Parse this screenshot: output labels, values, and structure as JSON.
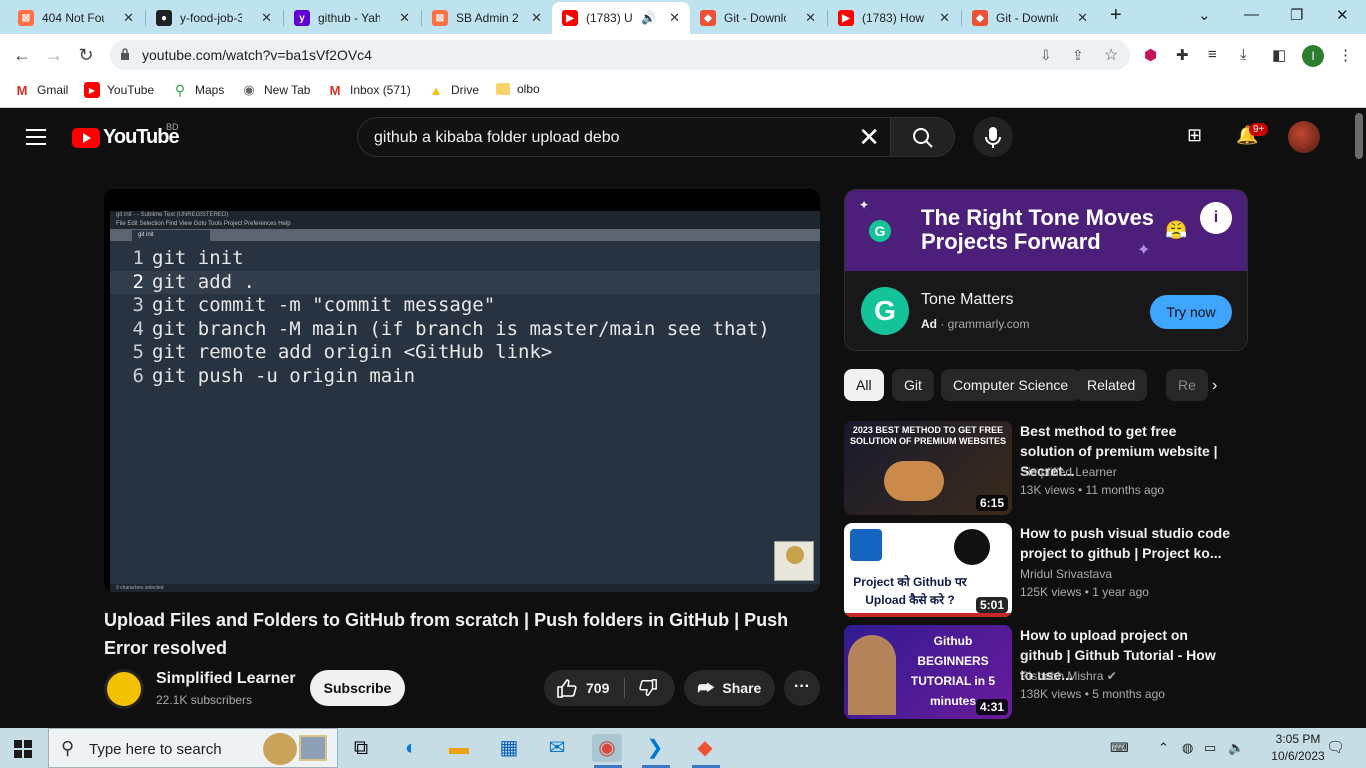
{
  "browser": {
    "tabs": [
      {
        "label": "404 Not Fou",
        "favicon_color": "#ff7043"
      },
      {
        "label": "y-food-job-3",
        "favicon_color": "#202124"
      },
      {
        "label": "github - Yah",
        "favicon_color": "#6001d2"
      },
      {
        "label": "SB Admin 2 -",
        "favicon_color": "#ff7043"
      },
      {
        "label": "(1783) U",
        "favicon_color": "#ff0000"
      },
      {
        "label": "Git - Downlo",
        "favicon_color": "#f05133"
      },
      {
        "label": "(1783) How t",
        "favicon_color": "#ff0000"
      },
      {
        "label": "Git - Downlo",
        "favicon_color": "#f05133"
      }
    ],
    "url": "youtube.com/watch?v=ba1sVf2OVc4",
    "profile_initial": "I",
    "bookmarks": [
      {
        "label": "Gmail"
      },
      {
        "label": "YouTube"
      },
      {
        "label": "Maps"
      },
      {
        "label": "New Tab"
      },
      {
        "label": "Inbox (571)"
      },
      {
        "label": "Drive"
      },
      {
        "label": "olbo"
      }
    ]
  },
  "youtube": {
    "logo_text": "YouTube",
    "country_code": "BD",
    "search_value": "github a kibaba folder upload debo",
    "notification_count": "9+",
    "video": {
      "editor_title": "git init - - Sublime Text (UNREGISTERED)",
      "editor_menu": "File  Edit  Selection  Find  View  Goto  Tools  Project  Preferences  Help",
      "editor_tab": "git init",
      "editor_status": "9 characters selected",
      "code_lines": [
        {
          "num": "1",
          "text": "git init"
        },
        {
          "num": "2",
          "text": "git add ."
        },
        {
          "num": "3",
          "text": "git commit -m \"commit message\""
        },
        {
          "num": "4",
          "text": "git branch -M main (if branch is master/main see that)"
        },
        {
          "num": "5",
          "text": "git remote add origin <GitHub link>"
        },
        {
          "num": "6",
          "text": "git push -u origin main"
        }
      ],
      "title": "Upload Files and Folders to GitHub from scratch | Push folders in GitHub | Push Error resolved",
      "channel": "Simplified Learner",
      "subscribers": "22.1K subscribers",
      "subscribe_label": "Subscribe",
      "likes": "709",
      "share_label": "Share"
    },
    "ad": {
      "headline": "The Right Tone Moves Projects Forward",
      "advertiser": "Tone Matters",
      "ad_label": "Ad",
      "domain": "grammarly.com",
      "cta": "Try now"
    },
    "chips": [
      "All",
      "Git",
      "Computer Science",
      "Related",
      "Re"
    ],
    "recommendations": [
      {
        "title": "Best method to get free solution of premium website | Secret...",
        "channel": "Simplified Learner",
        "meta": "13K views • 11 months ago",
        "duration": "6:15",
        "thumb_text": "2023 BEST METHOD TO GET FREE SOLUTION OF PREMIUM WEBSITES",
        "thumb_colors": [
          "#1a1a2e",
          "#c62828"
        ]
      },
      {
        "title": "How to push visual studio code project to github | Project ko...",
        "channel": "Mridul Srivastava",
        "meta": "125K views • 1 year ago",
        "duration": "5:01",
        "thumb_text": "Project को Github पर Upload कैसे करे ?",
        "thumb_colors": [
          "#ffffff",
          "#0d47a1"
        ]
      },
      {
        "title": "How to upload project on github | Github Tutorial - How to use...",
        "channel": "Rishabh Mishra",
        "meta": "138K views • 5 months ago",
        "duration": "4:31",
        "thumb_text": "Github BEGINNERS TUTORIAL in 5 minutes",
        "thumb_colors": [
          "#4a148c",
          "#f9a825"
        ]
      }
    ]
  },
  "taskbar": {
    "search_placeholder": "Type here to search",
    "time": "3:05 PM",
    "date": "10/6/2023"
  }
}
